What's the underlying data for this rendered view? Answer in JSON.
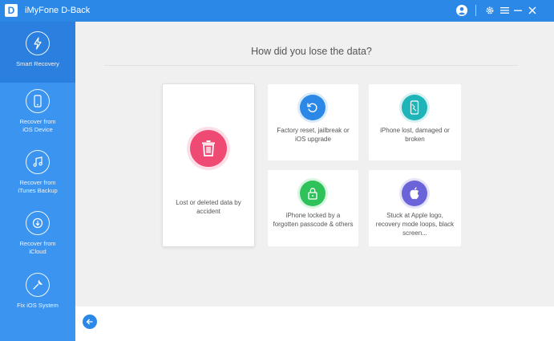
{
  "window": {
    "logo_letter": "D",
    "title": "iMyFone D-Back",
    "icons": [
      "user-icon",
      "gear-icon",
      "menu-icon",
      "minimize-icon",
      "close-icon"
    ]
  },
  "sidebar": {
    "items": [
      {
        "label": "Smart Recovery",
        "icon": "lightning-icon",
        "active": true
      },
      {
        "label": "Recover from\niOS Device",
        "icon": "phone-icon",
        "active": false
      },
      {
        "label": "Recover from\niTunes Backup",
        "icon": "music-note-icon",
        "active": false
      },
      {
        "label": "Recover from\niCloud",
        "icon": "cloud-download-icon",
        "active": false
      },
      {
        "label": "Fix iOS System",
        "icon": "wrench-icon",
        "active": false
      }
    ]
  },
  "main": {
    "heading": "How did you lose the data?",
    "cards": [
      {
        "label": "Lost or deleted data by accident",
        "icon": "trash-icon",
        "color": "#ef4a73",
        "selected": true
      },
      {
        "label": "Factory reset, jailbreak or iOS upgrade",
        "icon": "reset-icon",
        "color": "#2c88e6",
        "selected": false
      },
      {
        "label": "iPhone lost, damaged or broken",
        "icon": "broken-phone-icon",
        "color": "#1fb4b8",
        "selected": false
      },
      {
        "label": "iPhone locked by a forgotten passcode & others",
        "icon": "lock-icon",
        "color": "#2fc25b",
        "selected": false
      },
      {
        "label": "Stuck at Apple logo, recovery mode loops, black screen...",
        "icon": "apple-icon",
        "color": "#6b63d8",
        "selected": false
      }
    ]
  },
  "footer": {
    "back_icon": "back-arrow-icon"
  },
  "colors": {
    "titlebar": "#2c88e6",
    "sidebar": "#3b95f0",
    "sidebar_active": "#2a7fdf",
    "main_bg": "#f0f0f0"
  }
}
